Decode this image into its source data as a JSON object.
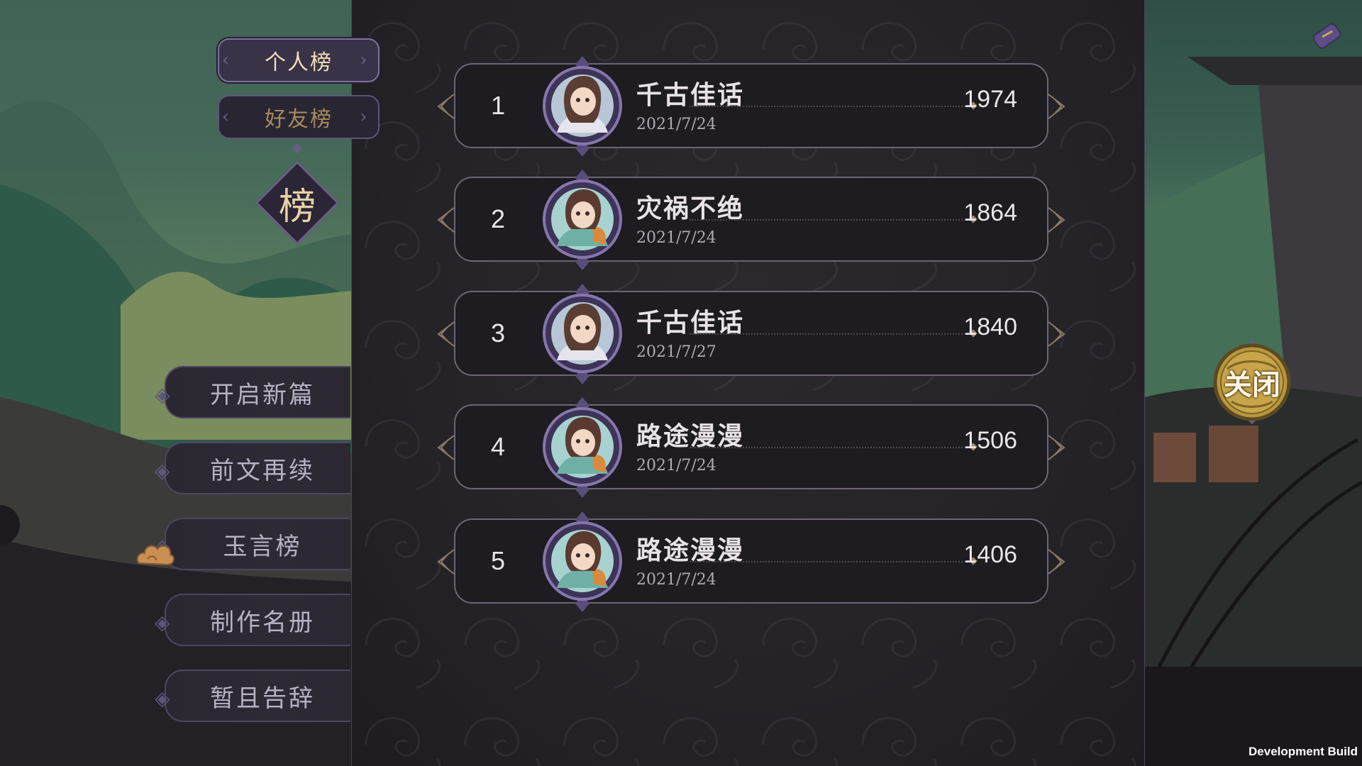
{
  "tabs": [
    {
      "label": "个人榜",
      "active": true
    },
    {
      "label": "好友榜",
      "active": false
    }
  ],
  "badge_label": "榜",
  "menu": [
    {
      "label": "开启新篇"
    },
    {
      "label": "前文再续"
    },
    {
      "label": "玉言榜"
    },
    {
      "label": "制作名册"
    },
    {
      "label": "暂且告辞"
    }
  ],
  "ranking": [
    {
      "rank": "1",
      "name": "千古佳话",
      "date": "2021/7/24",
      "score": "1974",
      "avatar": "girl-white-robe-icon"
    },
    {
      "rank": "2",
      "name": "灾祸不绝",
      "date": "2021/7/24",
      "score": "1864",
      "avatar": "girl-orange-scarf-icon"
    },
    {
      "rank": "3",
      "name": "千古佳话",
      "date": "2021/7/27",
      "score": "1840",
      "avatar": "girl-white-robe-icon"
    },
    {
      "rank": "4",
      "name": "路途漫漫",
      "date": "2021/7/24",
      "score": "1506",
      "avatar": "girl-orange-scarf-icon"
    },
    {
      "rank": "5",
      "name": "路途漫漫",
      "date": "2021/7/24",
      "score": "1406",
      "avatar": "girl-orange-scarf-icon"
    }
  ],
  "close_label": "关闭",
  "footer": {
    "build_label": "Development Build"
  },
  "colors": {
    "accent_gold": "#e7d2a6",
    "frame_purple": "#6b5e86",
    "panel_bg": "#252228"
  }
}
